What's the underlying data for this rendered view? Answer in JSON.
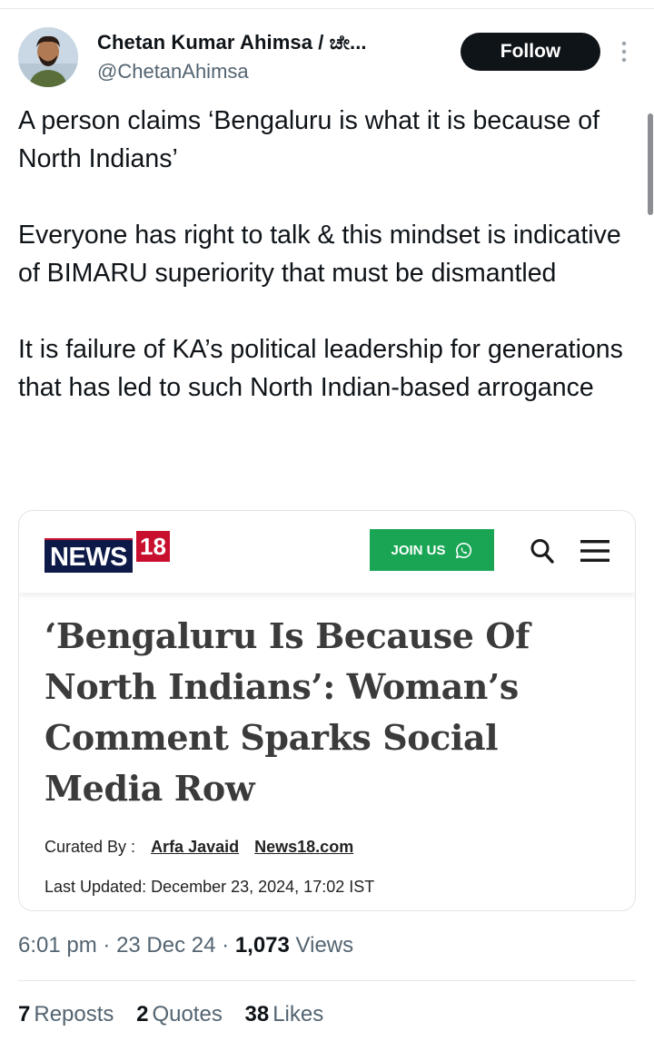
{
  "author": {
    "name": "Chetan Kumar Ahimsa / ಚೇ...",
    "handle": "@ChetanAhimsa",
    "follow_label": "Follow"
  },
  "tweet": {
    "paragraphs": [
      "A person claims ‘Bengaluru is what it is because of North Indians’",
      "Everyone has right to talk & this mindset is indicative of BIMARU superiority that must be dismantled",
      "It is failure of KA’s political leadership for generations that has led to such North Indian-based arrogance"
    ]
  },
  "card": {
    "logo_news": "NEWS",
    "logo_18": "18",
    "join_label": "JOIN US",
    "headline": "‘Bengaluru Is Because Of North Indians’: Woman’s Comment Sparks Social Media Row",
    "curated_label": "Curated By :",
    "curator": "Arfa Javaid",
    "source": "News18.com",
    "last_updated": "Last Updated: December 23, 2024, 17:02 IST"
  },
  "meta": {
    "time": "6:01 pm",
    "date": "23 Dec 24",
    "views_count": "1,073",
    "views_label": "Views",
    "sep": "·"
  },
  "stats": {
    "reposts_count": "7",
    "reposts_label": "Reposts",
    "quotes_count": "2",
    "quotes_label": "Quotes",
    "likes_count": "38",
    "likes_label": "Likes"
  },
  "colors": {
    "follow_bg": "#0f1419",
    "news_navy": "#0d1a48",
    "news_red": "#c8102e",
    "join_green": "#19a554",
    "muted_text": "#536471"
  },
  "icons": [
    "more-vertical-icon",
    "whatsapp-icon",
    "search-icon",
    "hamburger-menu-icon"
  ]
}
